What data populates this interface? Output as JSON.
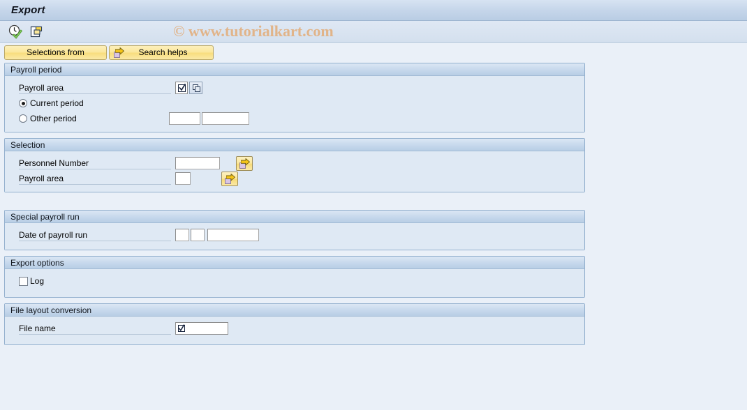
{
  "window": {
    "title": "Export"
  },
  "toolbar": {
    "icons": [
      {
        "name": "execute-clock-check-icon",
        "tooltip": "Execute"
      },
      {
        "name": "multiple-selection-copy-icon",
        "tooltip": "Copy"
      }
    ],
    "watermark": "© www.tutorialkart.com"
  },
  "buttonbar": {
    "selections_from_label": "Selections from",
    "search_helps_label": "Search helps"
  },
  "sections": {
    "payroll_period": {
      "title": "Payroll period",
      "payroll_area_label": "Payroll area",
      "payroll_area_value": "",
      "current_period_label": "Current period",
      "other_period_label": "Other period",
      "period_selected": "current",
      "other_period_value_1": "",
      "other_period_value_2": ""
    },
    "selection": {
      "title": "Selection",
      "personnel_number_label": "Personnel Number",
      "personnel_number_value": "",
      "payroll_area_label": "Payroll area",
      "payroll_area_value": ""
    },
    "special_payroll_run": {
      "title": "Special payroll run",
      "date_label": "Date of payroll run",
      "date_value_1": "",
      "date_value_2": "",
      "date_value_3": ""
    },
    "export_options": {
      "title": "Export options",
      "log_label": "Log",
      "log_checked": false
    },
    "file_layout_conversion": {
      "title": "File layout conversion",
      "file_name_label": "File name",
      "file_name_value": ""
    }
  },
  "colors": {
    "background": "#eaf0f8",
    "panel_bg": "#dee9f4",
    "panel_border": "#93b0ce",
    "title_bar": "#c6d6ea",
    "button_yellow": "#fbe79b",
    "watermark": "#e2b284"
  }
}
